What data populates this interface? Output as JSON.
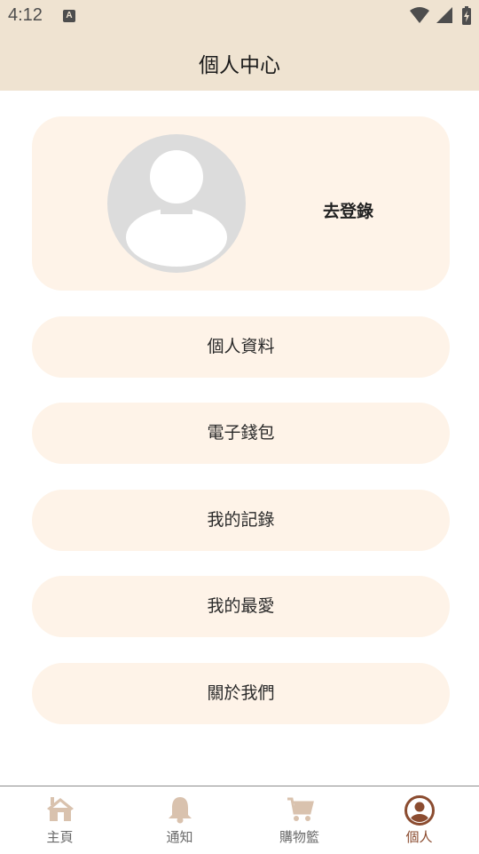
{
  "status": {
    "time": "4:12",
    "badge": "A"
  },
  "header": {
    "title": "個人中心"
  },
  "profile": {
    "login_label": "去登錄"
  },
  "menu": [
    {
      "label": "個人資料"
    },
    {
      "label": "電子錢包"
    },
    {
      "label": "我的記錄"
    },
    {
      "label": "我的最愛"
    },
    {
      "label": "關於我們"
    }
  ],
  "nav": [
    {
      "label": "主頁",
      "icon": "home-icon"
    },
    {
      "label": "通知",
      "icon": "bell-icon"
    },
    {
      "label": "購物籃",
      "icon": "cart-icon"
    },
    {
      "label": "個人",
      "icon": "profile-icon",
      "active": true
    }
  ],
  "colors": {
    "header_bg": "#efe3d1",
    "card_bg": "#fef3e8",
    "nav_active": "#8b4c30",
    "nav_inactive_icon": "#d9c2ae"
  }
}
